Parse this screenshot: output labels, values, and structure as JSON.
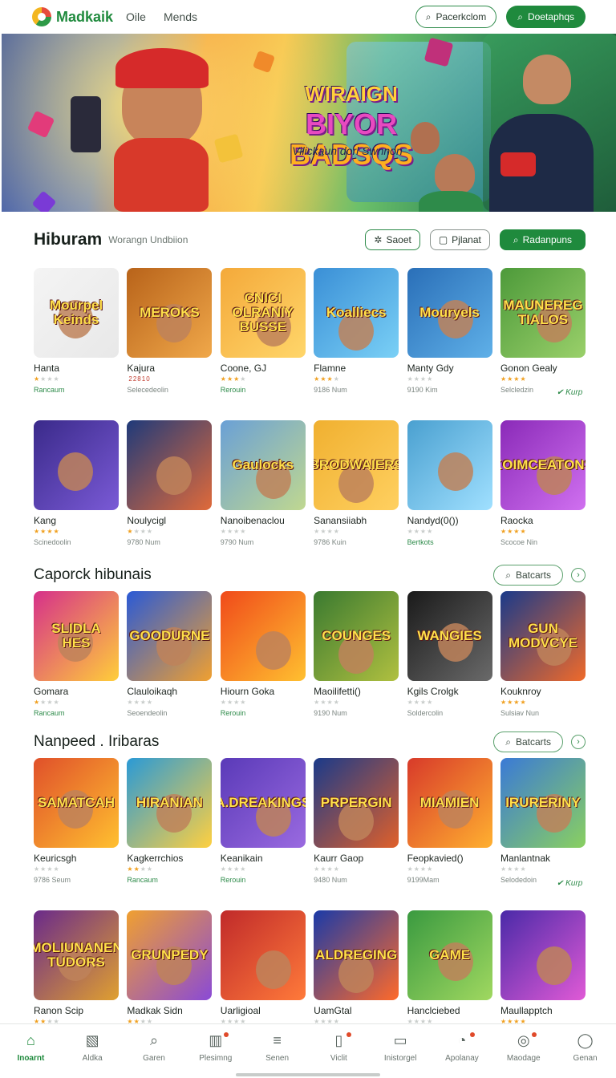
{
  "topbar": {
    "brand": "Madkaik",
    "nav": [
      "Oile",
      "Mends"
    ],
    "search_label": "Pacerkclom",
    "cta_label": "Doetaphqs"
  },
  "hero": {
    "title_line1": "WIRAIGN",
    "title_line2": "BIYOR",
    "title_line3": "BADSQS",
    "subtitle": "Vilickaun dorl Swnnon"
  },
  "section1": {
    "title": "Hiburam",
    "subtitle": "Worangn Undbiion",
    "chip1": "Saoet",
    "chip2": "Pjlanat",
    "chip3": "Radanpuns",
    "side_badge": "Kurp",
    "row1": [
      {
        "thumb": "Mourpel Keinds",
        "name": "Hanta",
        "stars": 1,
        "meta": "Rancaum"
      },
      {
        "thumb": "MEROKS",
        "name": "Kajura",
        "stars": 0,
        "meta": "Selecedeolin",
        "extra": "22810"
      },
      {
        "thumb": "CNICI OLRANIY BUSSE",
        "name": "Coone, GJ",
        "stars": 3,
        "meta": "Rerouin"
      },
      {
        "thumb": "Koalliecs",
        "name": "Flamne",
        "stars": 3,
        "meta": "9186 Num"
      },
      {
        "thumb": "Mouryels",
        "name": "Manty Gdy",
        "stars": 0,
        "meta": "9190 Kim"
      },
      {
        "thumb": "MAUNEREG TIALOS",
        "name": "Gonon Gealy",
        "stars": 4,
        "meta": "Selcledzin"
      }
    ],
    "row2": [
      {
        "thumb": "",
        "name": "Kang",
        "stars": 4,
        "meta": "Scinedoolin"
      },
      {
        "thumb": "",
        "name": "Noulycigl",
        "stars": 1,
        "meta": "9780 Num"
      },
      {
        "thumb": "Gaulocks",
        "name": "Nanoibenaclou",
        "stars": 0,
        "meta": "9790 Num"
      },
      {
        "thumb": "BRODWAIERS",
        "name": "Sanansiiabh",
        "stars": 0,
        "meta": "9786 Kuin"
      },
      {
        "thumb": "",
        "name": "Nandyd(0())",
        "stars": 0,
        "meta": "Bertkots"
      },
      {
        "thumb": "KOIMCEATONS",
        "name": "Raocka",
        "stars": 4,
        "meta": "Scocoe Nin"
      }
    ]
  },
  "section2": {
    "title": "Caporck hibunais",
    "more_label": "Batcarts",
    "row": [
      {
        "thumb": "SLIDLA HES",
        "name": "Gomara",
        "stars": 1,
        "meta": "Rancaum"
      },
      {
        "thumb": "GOODURNE",
        "name": "Clauloikaqh",
        "stars": 0,
        "meta": "Seoendeolin"
      },
      {
        "thumb": "",
        "name": "Hiourn Goka",
        "stars": 0,
        "meta": "Rerouin"
      },
      {
        "thumb": "COUNGES",
        "name": "Maoilifetti()",
        "stars": 0,
        "meta": "9190 Num"
      },
      {
        "thumb": "WANGIES",
        "name": "Kgils Crolgk",
        "stars": 0,
        "meta": "Soldercolin"
      },
      {
        "thumb": "GUN MODVCYE",
        "name": "Kouknroy",
        "stars": 4,
        "meta": "Sulsiav Nun"
      }
    ]
  },
  "section3": {
    "title": "Nanpeed . Iribaras",
    "more_label": "Batcarts",
    "side_badge": "Kurp",
    "row1": [
      {
        "thumb": "SAMATCAH",
        "name": "Keuricsgh",
        "stars": 0,
        "meta": "9786 Seum"
      },
      {
        "thumb": "HIRANIAN",
        "name": "Kagkerrchios",
        "stars": 2,
        "meta": "Rancaum"
      },
      {
        "thumb": "A.DREAKINGS",
        "name": "Keanikain",
        "stars": 0,
        "meta": "Rerouin"
      },
      {
        "thumb": "PRPERGIN",
        "name": "Kaurr Gaop",
        "stars": 0,
        "meta": "9480 Num"
      },
      {
        "thumb": "MIAMIEN",
        "name": "Feopkavied()",
        "stars": 0,
        "meta": "9199Mam"
      },
      {
        "thumb": "IRURERINY",
        "name": "Manlantnak",
        "stars": 0,
        "meta": "Selodedoin"
      }
    ],
    "row2": [
      {
        "thumb": "MOLIUNANEN TUDORS",
        "name": "Ranon Scip",
        "stars": 2,
        "meta": ""
      },
      {
        "thumb": "GRUNPEDY",
        "name": "Madkak Sidn",
        "stars": 2,
        "meta": ""
      },
      {
        "thumb": "",
        "name": "Uarligioal",
        "stars": 0,
        "meta": ""
      },
      {
        "thumb": "ALDREGING",
        "name": "UamGtal",
        "stars": 0,
        "meta": ""
      },
      {
        "thumb": "GAME",
        "name": "Hanclciebed",
        "stars": 0,
        "meta": ""
      },
      {
        "thumb": "",
        "name": "Maullapptch",
        "stars": 4,
        "meta": ""
      }
    ]
  },
  "bottom_nav": [
    {
      "label": "Inoarnt",
      "icon": "home-icon",
      "active": true
    },
    {
      "label": "Aldka",
      "icon": "image-icon"
    },
    {
      "label": "Garen",
      "icon": "search-icon"
    },
    {
      "label": "Plesimng",
      "icon": "book-icon"
    },
    {
      "label": "Senen",
      "icon": "list-icon"
    },
    {
      "label": "Viclit",
      "icon": "bookmark-icon"
    },
    {
      "label": "Inistorgel",
      "icon": "tablet-icon"
    },
    {
      "label": "Apolanay",
      "icon": "chat-icon"
    },
    {
      "label": "Maodage",
      "icon": "bell-icon"
    },
    {
      "label": "Genan",
      "icon": "user-icon"
    }
  ],
  "colors": {
    "accent": "#1f8a3d",
    "star": "#f0a020"
  }
}
